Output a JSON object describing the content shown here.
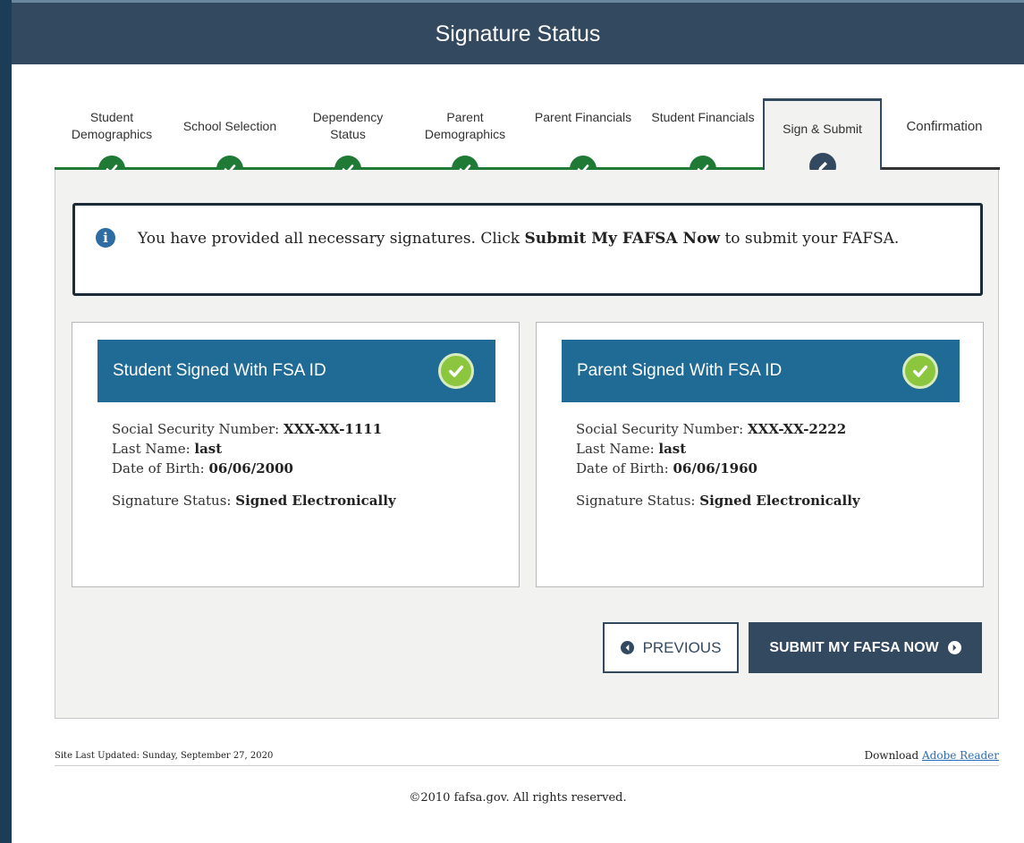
{
  "header": {
    "title": "Signature Status"
  },
  "steps": [
    {
      "label": "Student Demographics"
    },
    {
      "label": "School Selection"
    },
    {
      "label": "Dependency Status"
    },
    {
      "label": "Parent Demographics"
    },
    {
      "label": "Parent Financials"
    },
    {
      "label": "Student Financials"
    }
  ],
  "active_step": {
    "label": "Sign & Submit"
  },
  "next_step": {
    "label": "Confirmation"
  },
  "alert": {
    "text_before": "You have provided all necessary signatures. Click ",
    "text_bold": "Submit My FAFSA Now",
    "text_after": " to submit your FAFSA."
  },
  "cards": [
    {
      "title": "Student Signed With FSA ID",
      "ssn_label": "Social Security Number: ",
      "ssn": "XXX-XX-1111",
      "last_name_label": "Last Name: ",
      "last_name": "last",
      "dob_label": "Date of Birth: ",
      "dob": "06/06/2000",
      "status_label": "Signature Status: ",
      "status": "Signed Electronically"
    },
    {
      "title": "Parent Signed With FSA ID",
      "ssn_label": "Social Security Number: ",
      "ssn": "XXX-XX-2222",
      "last_name_label": "Last Name: ",
      "last_name": "last",
      "dob_label": "Date of Birth: ",
      "dob": "06/06/1960",
      "status_label": "Signature Status: ",
      "status": "Signed Electronically"
    }
  ],
  "buttons": {
    "previous": "PREVIOUS",
    "submit": "SUBMIT MY FAFSA NOW"
  },
  "footer": {
    "updated": "Site Last Updated: Sunday, September 27, 2020",
    "download_text": "Download ",
    "download_link": "Adobe Reader",
    "copyright": "©2010 fafsa.gov. All rights reserved."
  },
  "colors": {
    "header": "#33495f",
    "step_complete": "#1e7a35",
    "card_header": "#1f6b95",
    "check_badge": "#8cc63f"
  },
  "icons": {
    "step_done": "check-icon",
    "step_active": "pencil-icon",
    "alert": "info-icon",
    "card": "check-badge-icon",
    "prev": "arrow-left-circle-icon",
    "submit": "arrow-right-circle-icon"
  }
}
